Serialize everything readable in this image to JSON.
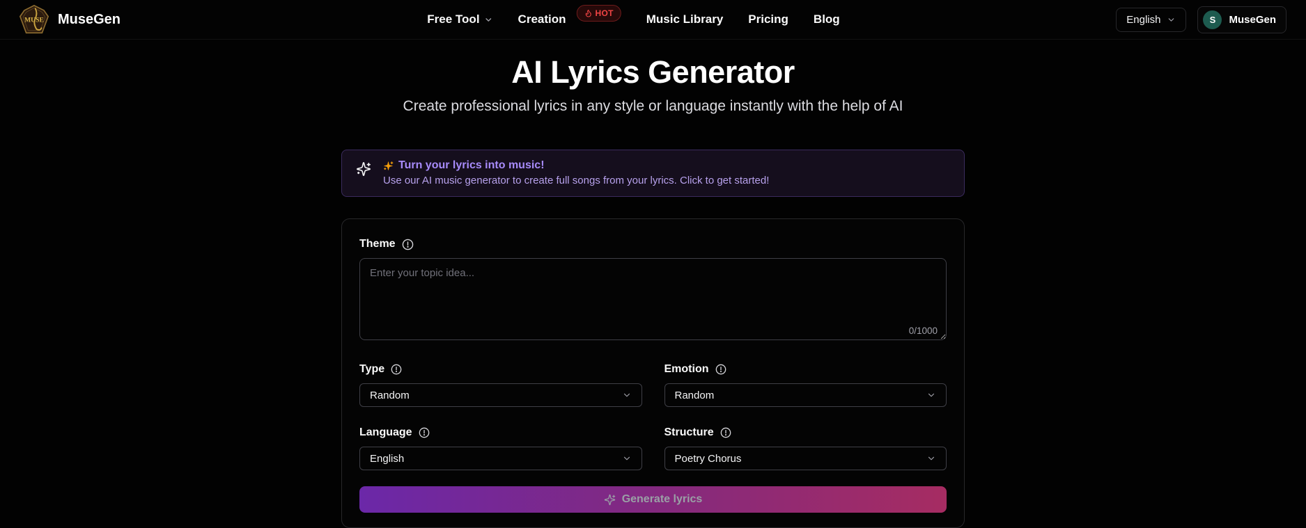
{
  "header": {
    "brand": "MuseGen",
    "logo_text": "MUSE",
    "nav": [
      {
        "label": "Free Tool",
        "has_dropdown": true
      },
      {
        "label": "Creation",
        "badge": "HOT"
      },
      {
        "label": "Music Library"
      },
      {
        "label": "Pricing"
      },
      {
        "label": "Blog"
      }
    ],
    "language": "English",
    "user": {
      "initial": "S",
      "name": "MuseGen"
    }
  },
  "hero": {
    "title": "AI Lyrics Generator",
    "subtitle": "Create professional lyrics in any style or language instantly with the help of AI"
  },
  "banner": {
    "title": "Turn your lyrics into music!",
    "body": "Use our AI music generator to create full songs from your lyrics. Click to get started!"
  },
  "form": {
    "theme": {
      "label": "Theme",
      "placeholder": "Enter your topic idea...",
      "counter": "0/1000"
    },
    "type": {
      "label": "Type",
      "value": "Random"
    },
    "emotion": {
      "label": "Emotion",
      "value": "Random"
    },
    "language": {
      "label": "Language",
      "value": "English"
    },
    "structure": {
      "label": "Structure",
      "value": "Poetry Chorus"
    },
    "submit": "Generate lyrics"
  },
  "icons": {
    "brand-logo": "muse-crest-saxophone",
    "nav-dropdown": "chevron-down",
    "hot-badge": "flame",
    "banner-left": "sparkles-white-outline",
    "banner-emoji": "sparkles-orange",
    "field-info": "circle-exclamation",
    "select": "chevron-down",
    "generate": "sparkles-outline"
  },
  "colors": {
    "background": "#020202",
    "accent_purple": "#a78bfa",
    "banner_bg": "#150e1d",
    "banner_border": "#3b2b5e",
    "hot_red": "#ef4444",
    "avatar_teal": "#1d5b4f",
    "button_gradient_start": "#6b28a8",
    "button_gradient_end": "#a62c62",
    "logo_gold": "#c9a23f",
    "field_border": "#3f3f46"
  }
}
